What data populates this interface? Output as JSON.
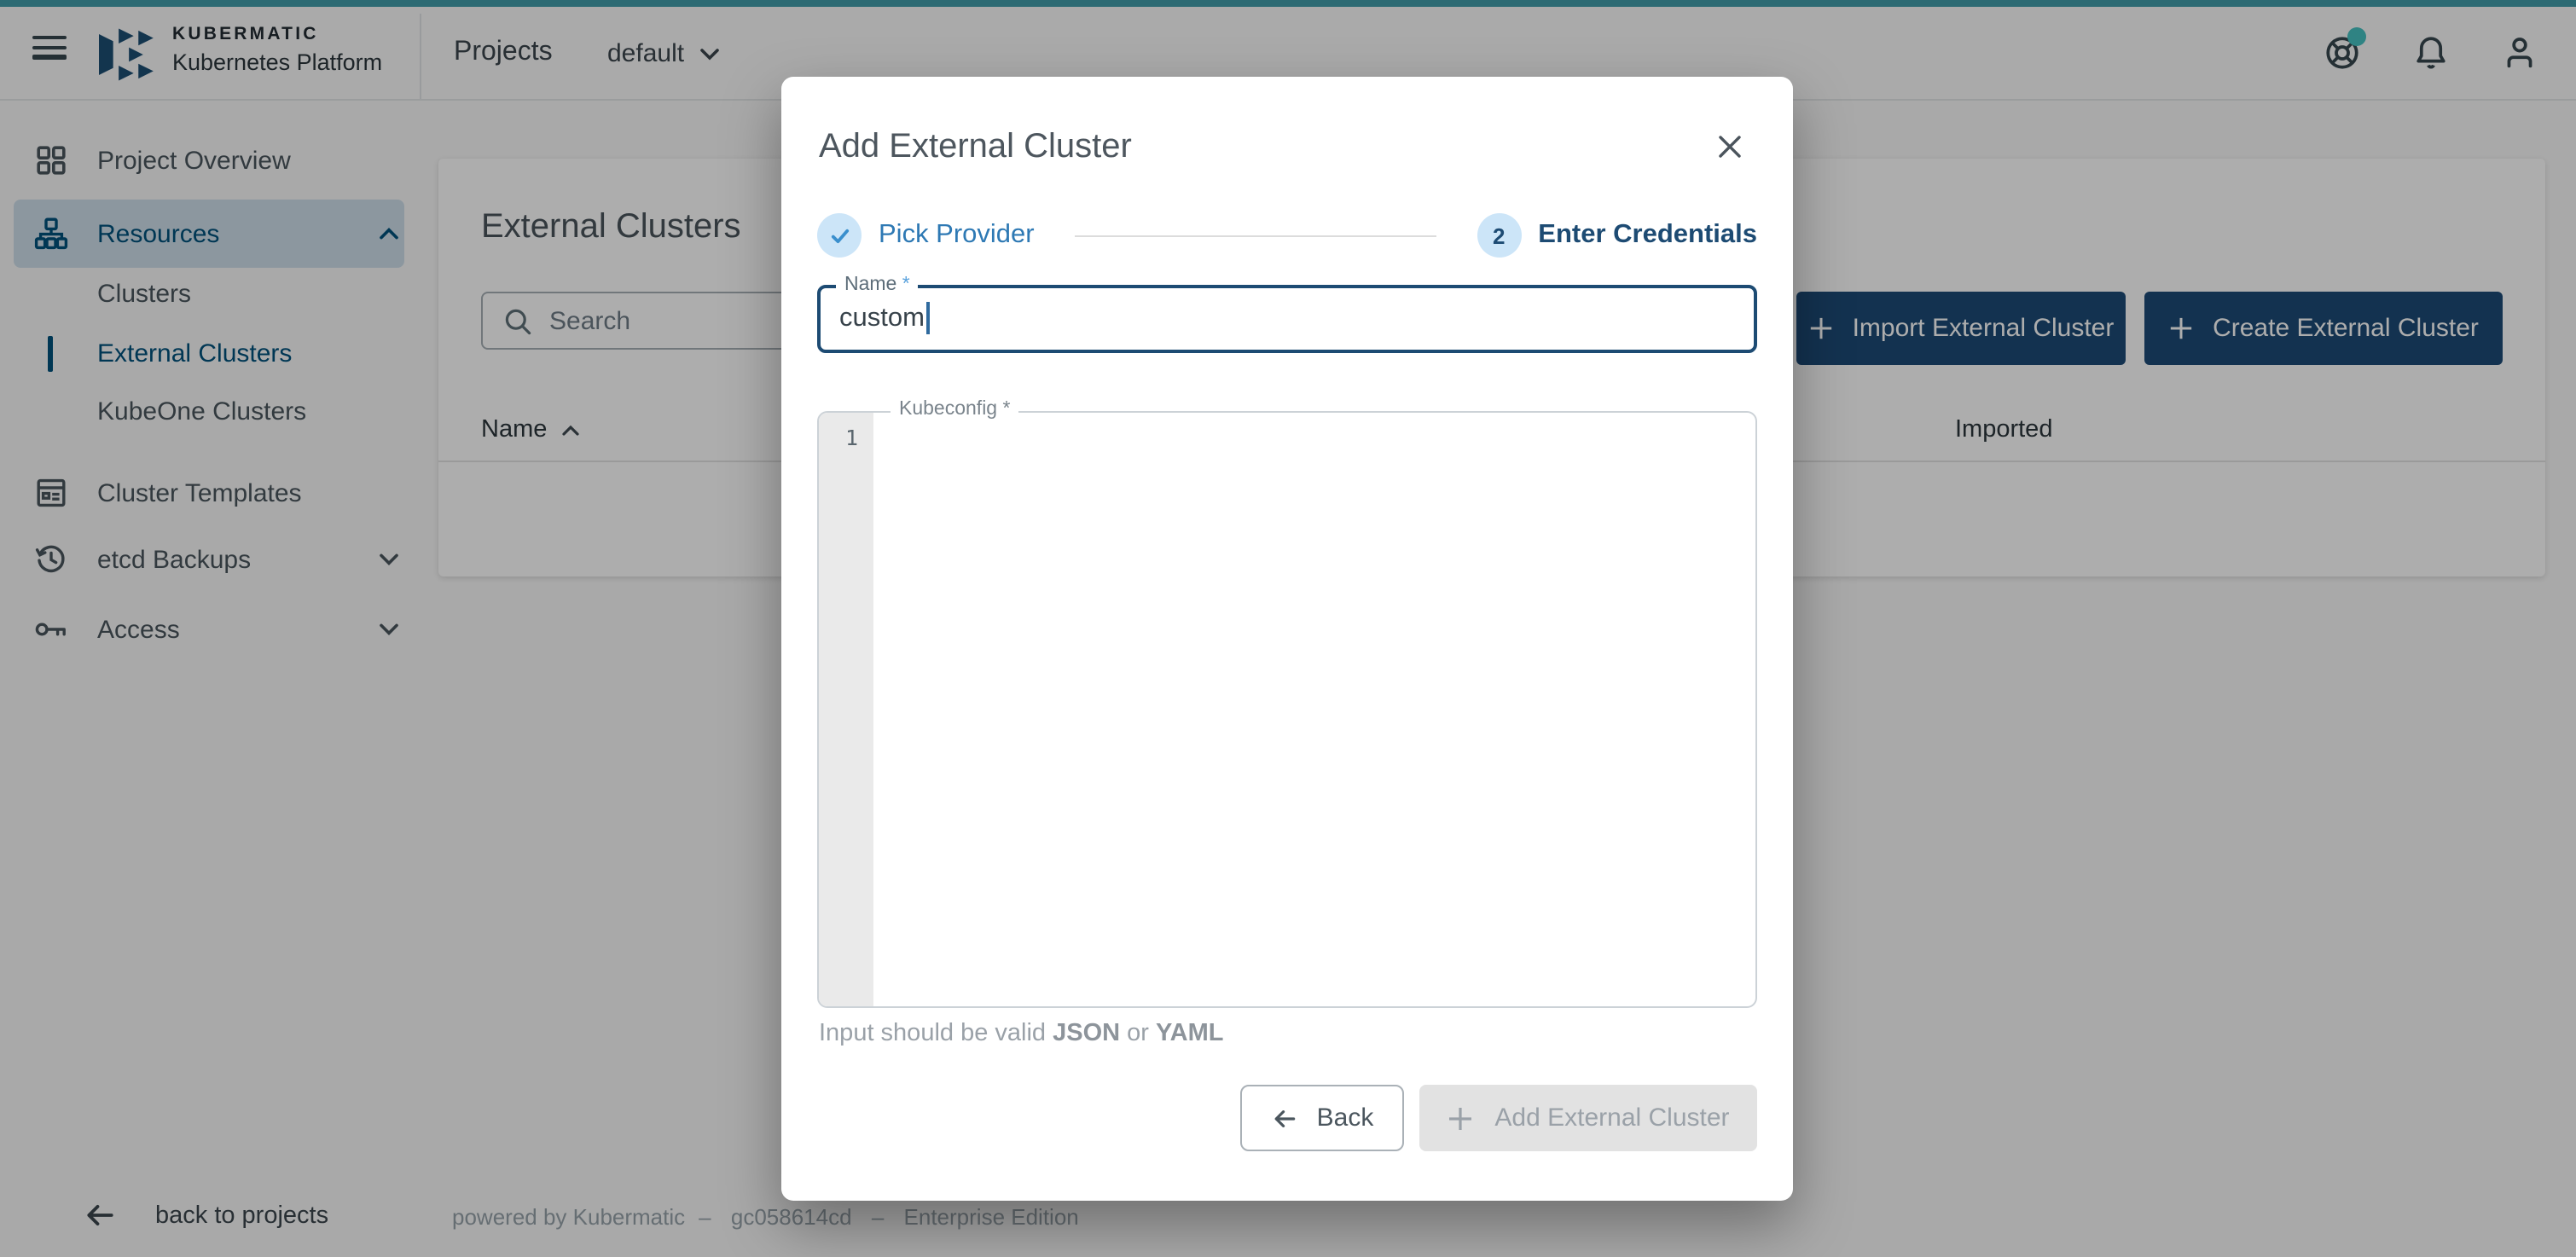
{
  "topbar": {
    "brand_title": "KUBERMATIC",
    "brand_subtitle": "Kubernetes Platform",
    "nav_label": "Projects",
    "project_selector": "default"
  },
  "sidebar": {
    "items": [
      {
        "label": "Project Overview"
      },
      {
        "label": "Resources"
      },
      {
        "label": "Clusters"
      },
      {
        "label": "External Clusters"
      },
      {
        "label": "KubeOne Clusters"
      },
      {
        "label": "Cluster Templates"
      },
      {
        "label": "etcd Backups"
      },
      {
        "label": "Access"
      }
    ]
  },
  "main": {
    "title": "External Clusters",
    "search_placeholder": "Search",
    "import_button": "Import External Cluster",
    "create_button": "Create External Cluster",
    "table": {
      "columns": [
        "Name",
        "Imported"
      ],
      "rows": []
    }
  },
  "modal": {
    "title": "Add External Cluster",
    "steps": [
      {
        "label": "Pick Provider",
        "state": "done"
      },
      {
        "label": "Enter Credentials",
        "number": "2",
        "state": "active"
      }
    ],
    "name_field": {
      "label": "Name",
      "required_marker": "*",
      "value": "custom"
    },
    "kubeconfig_field": {
      "label": "Kubeconfig",
      "required_marker": "*",
      "line_number": "1",
      "value": ""
    },
    "hint": {
      "prefix": "Input should be valid ",
      "strong1": "JSON",
      "middle": " or ",
      "strong2": "YAML"
    },
    "back_button": "Back",
    "submit_button": "Add External Cluster"
  },
  "footer": {
    "back_link": "back to projects",
    "powered_by": "powered by Kubermatic",
    "separator": "–",
    "version": "gc058614cd",
    "edition": "Enterprise Edition"
  },
  "colors": {
    "primary_navy": "#1d4b76",
    "active_blue": "#00517d",
    "teal_strip": "#419caa",
    "badge_teal": "#46c1c1",
    "step_done_blue": "#2e79b4",
    "step_active_navy": "#1d4b73"
  }
}
